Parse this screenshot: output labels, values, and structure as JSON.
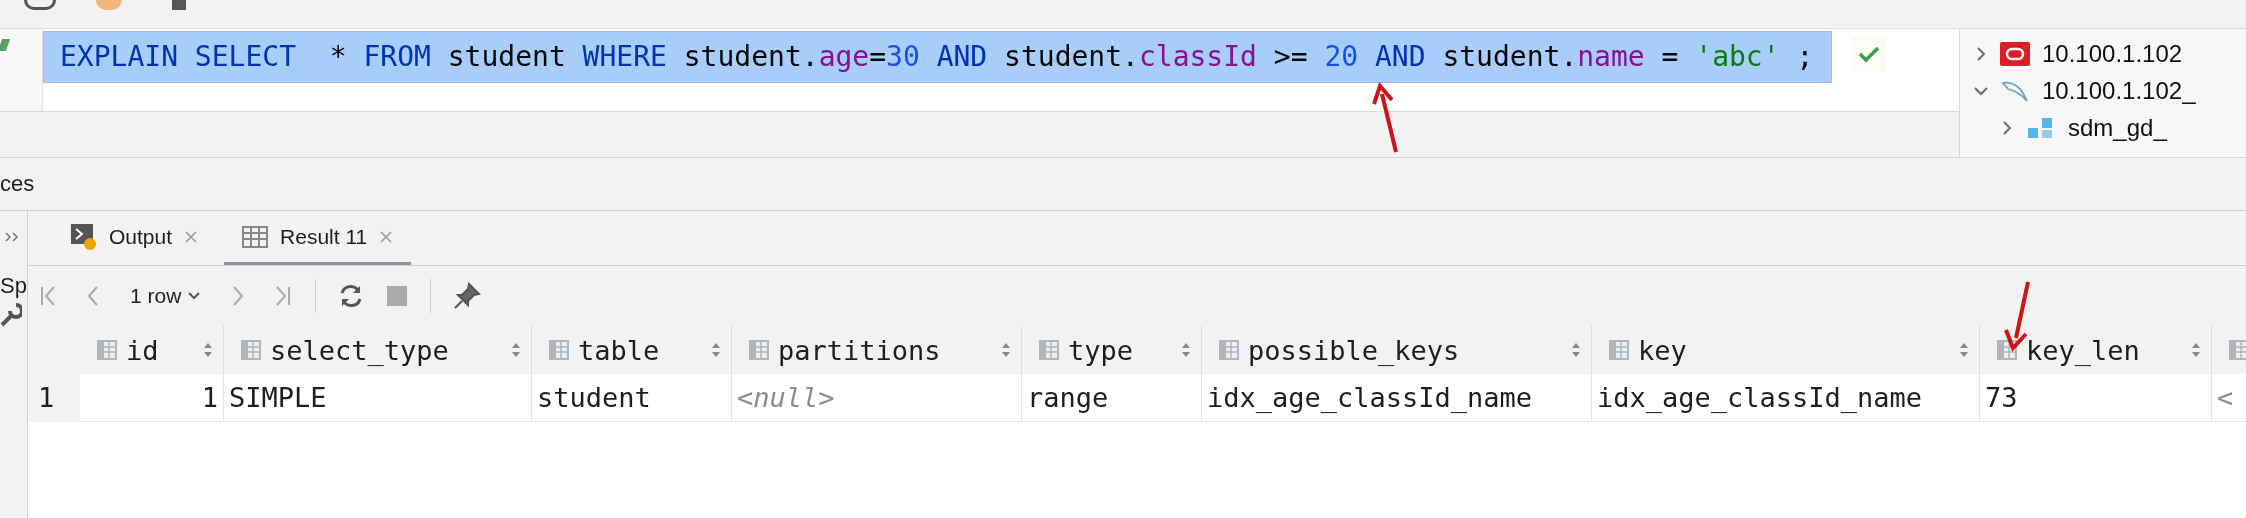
{
  "editor": {
    "selected": true,
    "tokens": [
      {
        "text": "EXPLAIN SELECT",
        "kind": "keyword"
      },
      {
        "text": "  * ",
        "kind": "plain"
      },
      {
        "text": "FROM",
        "kind": "keyword"
      },
      {
        "text": " student ",
        "kind": "plain"
      },
      {
        "text": "WHERE",
        "kind": "keyword"
      },
      {
        "text": " student.",
        "kind": "plain"
      },
      {
        "text": "age",
        "kind": "field"
      },
      {
        "text": "=",
        "kind": "plain"
      },
      {
        "text": "30",
        "kind": "number"
      },
      {
        "text": " AND",
        "kind": "keyword"
      },
      {
        "text": " student.",
        "kind": "plain"
      },
      {
        "text": "classId",
        "kind": "field"
      },
      {
        "text": " >= ",
        "kind": "plain"
      },
      {
        "text": "20",
        "kind": "number"
      },
      {
        "text": " AND",
        "kind": "keyword"
      },
      {
        "text": " student.",
        "kind": "plain"
      },
      {
        "text": "name",
        "kind": "field"
      },
      {
        "text": " = ",
        "kind": "plain"
      },
      {
        "text": "'abc'",
        "kind": "string"
      },
      {
        "text": " ;",
        "kind": "plain"
      }
    ]
  },
  "explorer": {
    "items": [
      {
        "label": "10.100.1.102",
        "kind": "oracle",
        "expanded": false
      },
      {
        "label": "10.100.1.102_",
        "kind": "mysql",
        "expanded": true,
        "children": [
          {
            "label": "sdm_gd_",
            "kind": "schema",
            "expanded": false
          }
        ]
      }
    ]
  },
  "panel": {
    "title": "ces",
    "side_label": "Sp"
  },
  "tabs": [
    {
      "label": "Output",
      "kind": "output",
      "selected": false
    },
    {
      "label": "Result 11",
      "kind": "table",
      "selected": true
    }
  ],
  "toolbar": {
    "first_disabled": true,
    "prev_disabled": true,
    "rows_label": "1 row",
    "next_disabled": true,
    "last_disabled": true,
    "stop_disabled": true
  },
  "table": {
    "columns": [
      {
        "name": "id"
      },
      {
        "name": "select_type"
      },
      {
        "name": "table"
      },
      {
        "name": "partitions"
      },
      {
        "name": "type"
      },
      {
        "name": "possible_keys"
      },
      {
        "name": "key"
      },
      {
        "name": "key_len"
      },
      {}
    ],
    "rows": [
      {
        "number": "1",
        "cells": [
          {
            "text": "1",
            "kind": "number"
          },
          {
            "text": "SIMPLE",
            "kind": "text"
          },
          {
            "text": "student",
            "kind": "text"
          },
          {
            "text": "<null>",
            "kind": "null"
          },
          {
            "text": "range",
            "kind": "text"
          },
          {
            "text": "idx_age_classId_name",
            "kind": "text"
          },
          {
            "text": "idx_age_classId_name",
            "kind": "text"
          },
          {
            "text": "73",
            "kind": "text"
          },
          {
            "text": "<",
            "kind": "null"
          }
        ]
      }
    ]
  }
}
